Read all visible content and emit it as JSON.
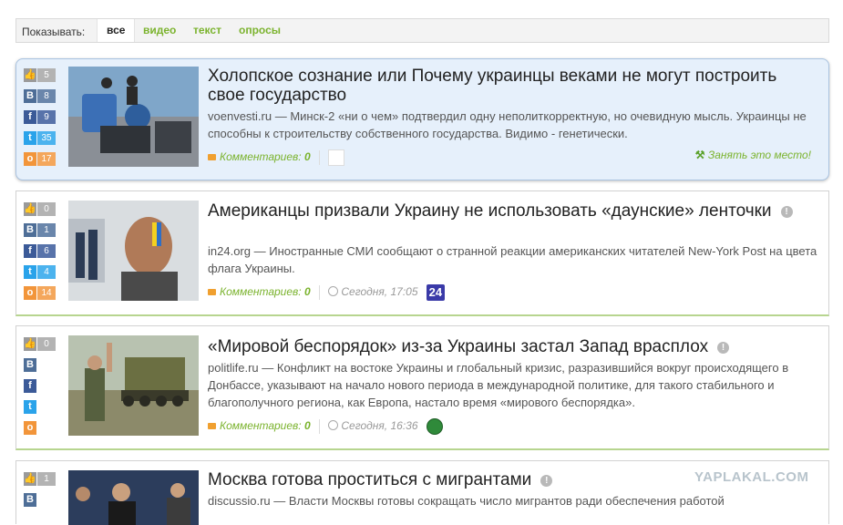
{
  "filter": {
    "label": "Показывать:",
    "tabs": [
      "все",
      "видео",
      "текст",
      "опросы"
    ],
    "active_tab": "все"
  },
  "colors": {
    "like": "#9a9a9a",
    "vk": "#4e6e97",
    "fb": "#3b5a98",
    "tw": "#2aa3ea",
    "ok": "#f2953a",
    "accent": "#7bb32e"
  },
  "comments_label": "Комментариев:",
  "take_place_label": "Занять это место!",
  "watermark": "YAPLAKAL.COM",
  "posts": [
    {
      "title": "Холопское сознание или Почему украинцы веками не могут построить свое государство",
      "source": "voenvesti.ru",
      "text": "— Минск-2 «ни о чем» подтвердил одну неполиткорректную, но очевидную мысль. Украинцы не способны к строительству собственного государства. Видимо - генетически.",
      "comments": "0",
      "counts": {
        "like": "5",
        "vk": "8",
        "fb": "9",
        "tw": "35",
        "ok": "17"
      }
    },
    {
      "title": "Американцы призвали Украину не использовать «даунские» ленточки",
      "source": "in24.org",
      "text": "— Иностранные СМИ сообщают о странной реакции американских читателей New-York Post на цвета флага Украины.",
      "comments": "0",
      "time": "Сегодня, 17:05",
      "badge": "24",
      "counts": {
        "like": "0",
        "vk": "1",
        "fb": "6",
        "tw": "4",
        "ok": "14"
      }
    },
    {
      "title": "«Мировой беспорядок» из-за Украины застал Запад врасплох",
      "source": "politlife.ru",
      "text": "— Конфликт на востоке Украины и глобальный кризис, разразившийся вокруг происходящего в Донбассе, указывают на начало нового периода в международной политике, для такого стабильного и благополучного региона, как Европа, настало время «мирового беспорядка».",
      "comments": "0",
      "time": "Сегодня, 16:36",
      "counts": {
        "like": "0"
      }
    },
    {
      "title": "Москва готова проститься с мигрантами",
      "source": "discussio.ru",
      "text": "— Власти Москвы готовы сокращать число мигрантов ради обеспечения работой",
      "counts": {
        "like": "1"
      }
    }
  ]
}
